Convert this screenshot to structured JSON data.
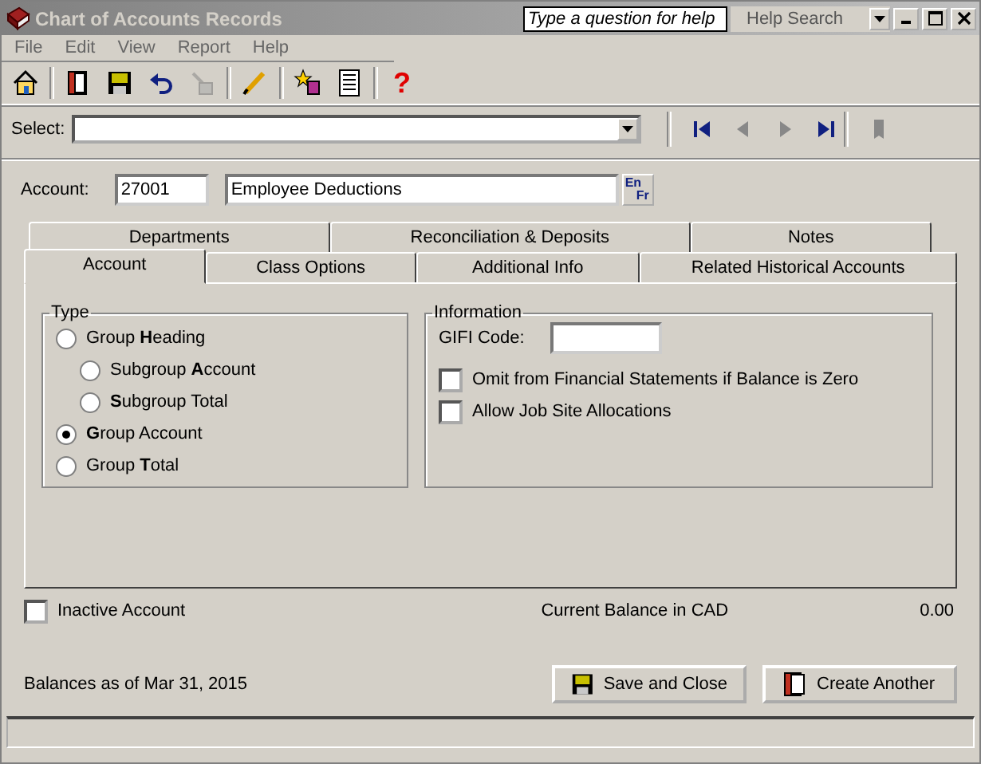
{
  "window": {
    "title": "Chart of Accounts Records",
    "help_placeholder": "Type a question for help",
    "help_search": "Help Search"
  },
  "menu": [
    "File",
    "Edit",
    "View",
    "Report",
    "Help"
  ],
  "toolbar": [
    {
      "disabled": false
    },
    {
      "disabled": false
    },
    {
      "disabled": false
    },
    {
      "disabled": false
    },
    {
      "disabled": true
    },
    {
      "disabled": false
    },
    {
      "disabled": false
    },
    {
      "disabled": false
    },
    {
      "disabled": false,
      "glyph": "?"
    }
  ],
  "select": {
    "label": "Select:"
  },
  "nav": [
    {
      "disabled": false
    },
    {
      "disabled": true
    },
    {
      "disabled": true
    },
    {
      "disabled": false
    },
    {
      "disabled": true
    }
  ],
  "account": {
    "label": "Account:",
    "number": "27001",
    "name": "Employee Deductions",
    "lang_top": "En",
    "lang_bottom": "Fr"
  },
  "tabs_back": [
    {
      "label": "Departments",
      "selected": false
    },
    {
      "label": "Reconciliation & Deposits",
      "selected": false
    },
    {
      "label": "Notes",
      "selected": false
    }
  ],
  "tabs_front": [
    {
      "label": "Account",
      "selected": true
    },
    {
      "label": "Class Options",
      "selected": false
    },
    {
      "label": "Additional Info",
      "selected": false
    },
    {
      "label": "Related Historical Accounts",
      "selected": false
    }
  ],
  "type_group": {
    "title": "Type",
    "options": [
      {
        "label": "Group **H**eading",
        "selected": false,
        "children": [
          {
            "label": "Subgroup **A**ccount",
            "selected": false
          },
          {
            "label": "**S**ubgroup Total",
            "selected": false
          }
        ]
      },
      {
        "label": "**G**roup Account",
        "selected": true
      },
      {
        "label": "Group **T**otal",
        "selected": false
      }
    ]
  },
  "info_group": {
    "title": "Information",
    "gifi_label": "GIFI Code:",
    "checks": [
      {
        "label": "Omit from Financial Statements if Balance is Zero",
        "checked": false
      },
      {
        "label": "Allow Job Site Allocations",
        "checked": false
      }
    ]
  },
  "inactive": {
    "label": "Inactive Account",
    "checked": false
  },
  "balance": {
    "label": "Current Balance in  CAD",
    "value": "0.00"
  },
  "balances_as_of": "Balances as of Mar 31, 2015",
  "buttons": [
    {
      "label": "Save and Close",
      "kind": "save"
    },
    {
      "label": "Create Another",
      "kind": "create"
    }
  ]
}
